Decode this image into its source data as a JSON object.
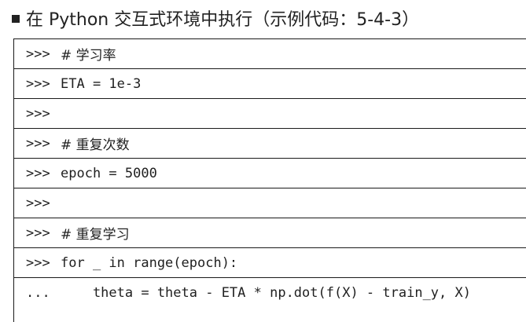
{
  "heading": {
    "bullet_icon": "square-bullet-icon",
    "text": "在 Python 交互式环境中执行（示例代码：5-4-3）"
  },
  "code_block": {
    "rows": [
      {
        "prompt": ">>>",
        "code": "# 学习率"
      },
      {
        "prompt": ">>>",
        "code": "ETA = 1e-3"
      },
      {
        "prompt": ">>>",
        "code": ""
      },
      {
        "prompt": ">>>",
        "code": "# 重复次数"
      },
      {
        "prompt": ">>>",
        "code": "epoch = 5000"
      },
      {
        "prompt": ">>>",
        "code": ""
      },
      {
        "prompt": ">>>",
        "code": "# 重复学习"
      },
      {
        "prompt": ">>>",
        "code": "for _ in range(epoch):"
      },
      {
        "prompt": "...",
        "code": "    theta = theta - ETA * np.dot(f(X) - train_y, X)"
      }
    ]
  }
}
